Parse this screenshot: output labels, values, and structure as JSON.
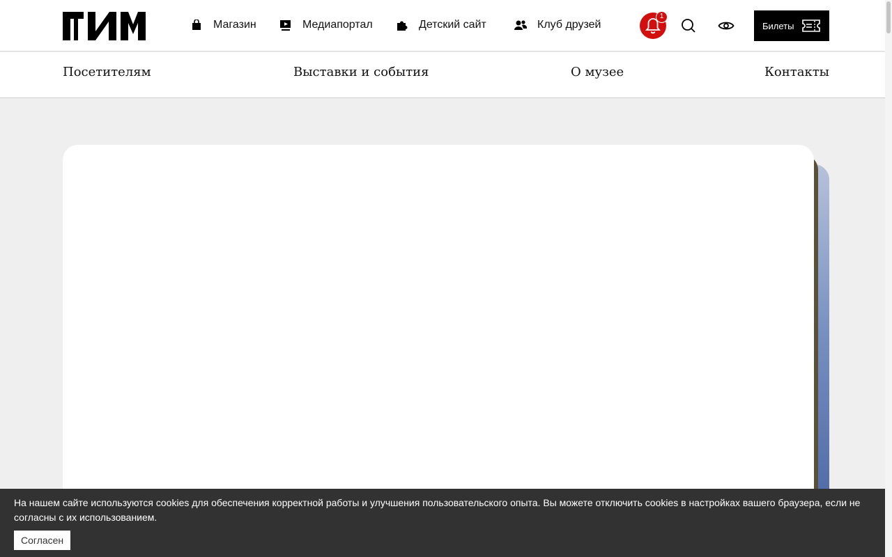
{
  "header": {
    "logo_text": "ГИМ",
    "links": [
      {
        "label": "Магазин",
        "icon": "shopping-bag-icon"
      },
      {
        "label": "Медиапортал",
        "icon": "media-play-icon"
      },
      {
        "label": "Детский сайт",
        "icon": "puzzle-piece-icon"
      },
      {
        "label": "Клуб друзей",
        "icon": "users-icon"
      }
    ],
    "notification_count": "1",
    "tickets_label": "Билеты"
  },
  "nav": {
    "items": [
      "Посетителям",
      "Выставки и события",
      "О музее",
      "Контакты"
    ]
  },
  "cookie": {
    "text": "На нашем сайте используются cookies для обеспечения корректной работы и улучшения пользовательского опыта. Вы можете отключить cookies в настройках вашего браузера, если не согласны с их использованием.",
    "button_label": "Согласен"
  },
  "colors": {
    "accent_red": "#d20f0f",
    "cookie_bg": "#323232",
    "page_bg": "#efefef"
  }
}
